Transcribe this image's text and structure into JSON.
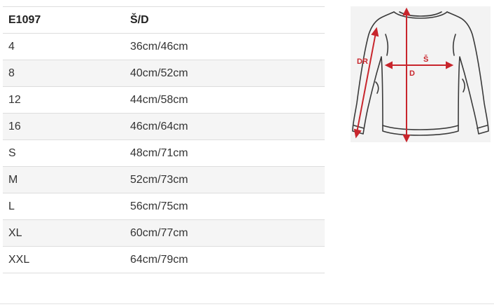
{
  "table": {
    "headers": [
      "E1097",
      "Š/D"
    ],
    "rows": [
      [
        "4",
        "36cm/46cm"
      ],
      [
        "8",
        "40cm/52cm"
      ],
      [
        "12",
        "44cm/58cm"
      ],
      [
        "16",
        "46cm/64cm"
      ],
      [
        "S",
        "48cm/71cm"
      ],
      [
        "M",
        "52cm/73cm"
      ],
      [
        "L",
        "56cm/75cm"
      ],
      [
        "XL",
        "60cm/77cm"
      ],
      [
        "XXL",
        "64cm/79cm"
      ]
    ]
  },
  "diagram": {
    "labels": {
      "sleeve": "DR",
      "width": "Š",
      "length": "D"
    },
    "colors": {
      "outline": "#3a3a3a",
      "measure": "#c8252c",
      "background": "#f3f3f3"
    }
  }
}
